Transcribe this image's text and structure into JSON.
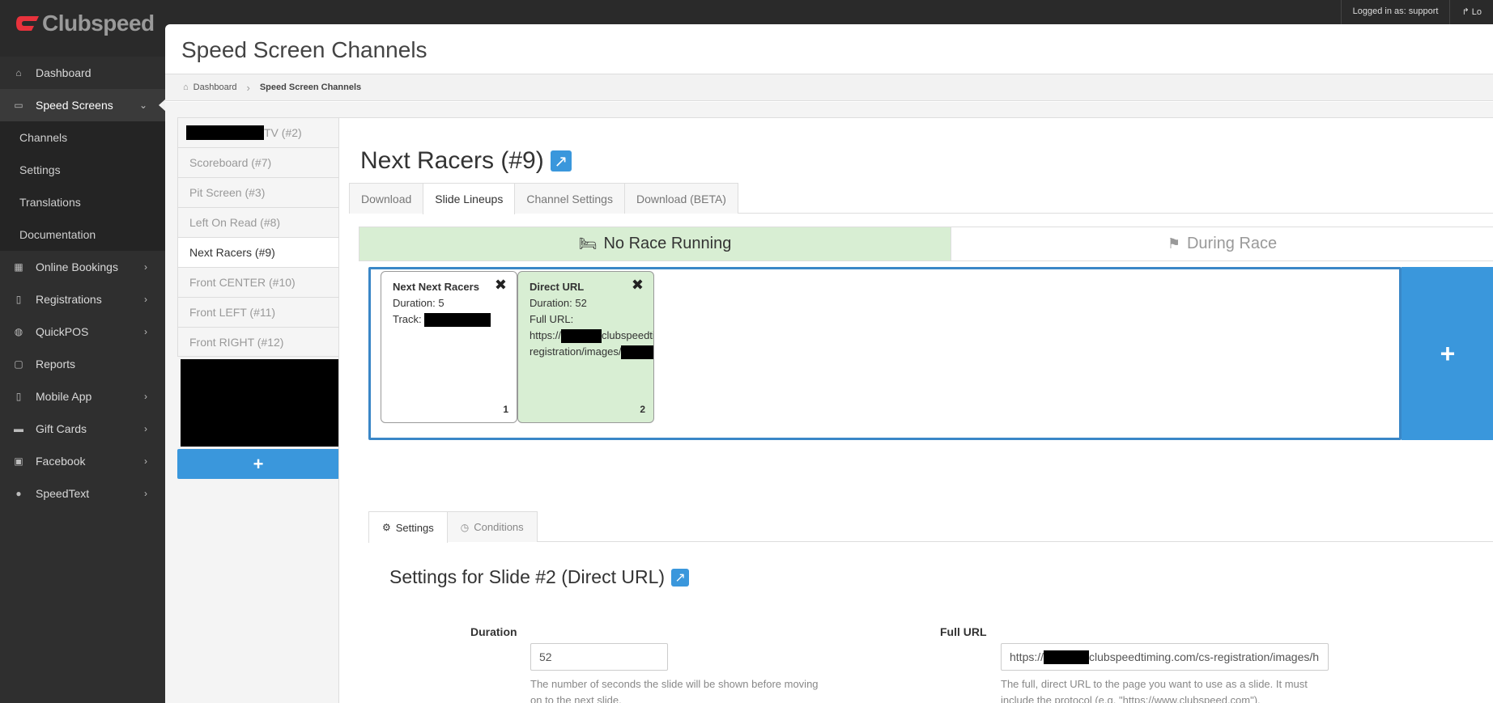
{
  "brand": {
    "name": "Clubspeed",
    "accent": "#e8323c"
  },
  "topbar": {
    "logged_in": "Logged in as: support",
    "logout": "Lo"
  },
  "sidebar": {
    "items": [
      {
        "label": "Dashboard",
        "icon": "home-icon"
      },
      {
        "label": "Speed Screens",
        "icon": "monitor-icon",
        "active": true
      },
      {
        "label": "Online Bookings",
        "icon": "calendar-icon"
      },
      {
        "label": "Registrations",
        "icon": "tablet-icon"
      },
      {
        "label": "QuickPOS",
        "icon": "dashboard-icon"
      },
      {
        "label": "Reports",
        "icon": "file-icon"
      },
      {
        "label": "Mobile App",
        "icon": "mobile-icon"
      },
      {
        "label": "Gift Cards",
        "icon": "credit-card-icon"
      },
      {
        "label": "Facebook",
        "icon": "facebook-icon"
      },
      {
        "label": "SpeedText",
        "icon": "comments-icon"
      }
    ],
    "subitems": [
      "Channels",
      "Settings",
      "Translations",
      "Documentation"
    ]
  },
  "page": {
    "title": "Speed Screen Channels"
  },
  "breadcrumb": {
    "home": "Dashboard",
    "current": "Speed Screen Channels"
  },
  "channels": [
    {
      "label": "TV (#2)",
      "redacted": true
    },
    {
      "label": "Scoreboard (#7)"
    },
    {
      "label": "Pit Screen (#3)"
    },
    {
      "label": "Left On Read (#8)"
    },
    {
      "label": "Next Racers (#9)",
      "active": true
    },
    {
      "label": "Front CENTER (#10)"
    },
    {
      "label": "Front LEFT (#11)"
    },
    {
      "label": "Front RIGHT (#12)"
    }
  ],
  "add_symbol": "+",
  "channel": {
    "title": "Next Racers (#9)",
    "tabs": [
      "Download",
      "Slide Lineups",
      "Channel Settings",
      "Download (BETA)"
    ],
    "active_tab": "Slide Lineups",
    "race_states": [
      "No Race Running",
      "During Race"
    ]
  },
  "slides": [
    {
      "name": "Next Next Racers",
      "line1": "Duration: 5",
      "line2": "Track: ",
      "number": "1"
    },
    {
      "name": "Direct URL",
      "line1": "Duration: 52",
      "line2": "Full URL:",
      "url1a": "https://",
      "url1b": "clubspeedtimi",
      "url2": "registration/images/",
      "number": "2"
    }
  ],
  "slide_settings": {
    "tabs": [
      "Settings",
      "Conditions"
    ],
    "title": "Settings for Slide #2 (Direct URL)",
    "duration_label": "Duration",
    "duration_value": "52",
    "duration_help": "The number of seconds the slide will be shown before moving on to the next slide.",
    "url_label": "Full URL",
    "url_value_a": "https://",
    "url_value_b": "clubspeedtiming.com/cs-registration/images/h",
    "url_help": "The full, direct URL to the page you want to use as a slide. It must include the protocol (e.g. \"https://www.clubspeed.com\")."
  }
}
